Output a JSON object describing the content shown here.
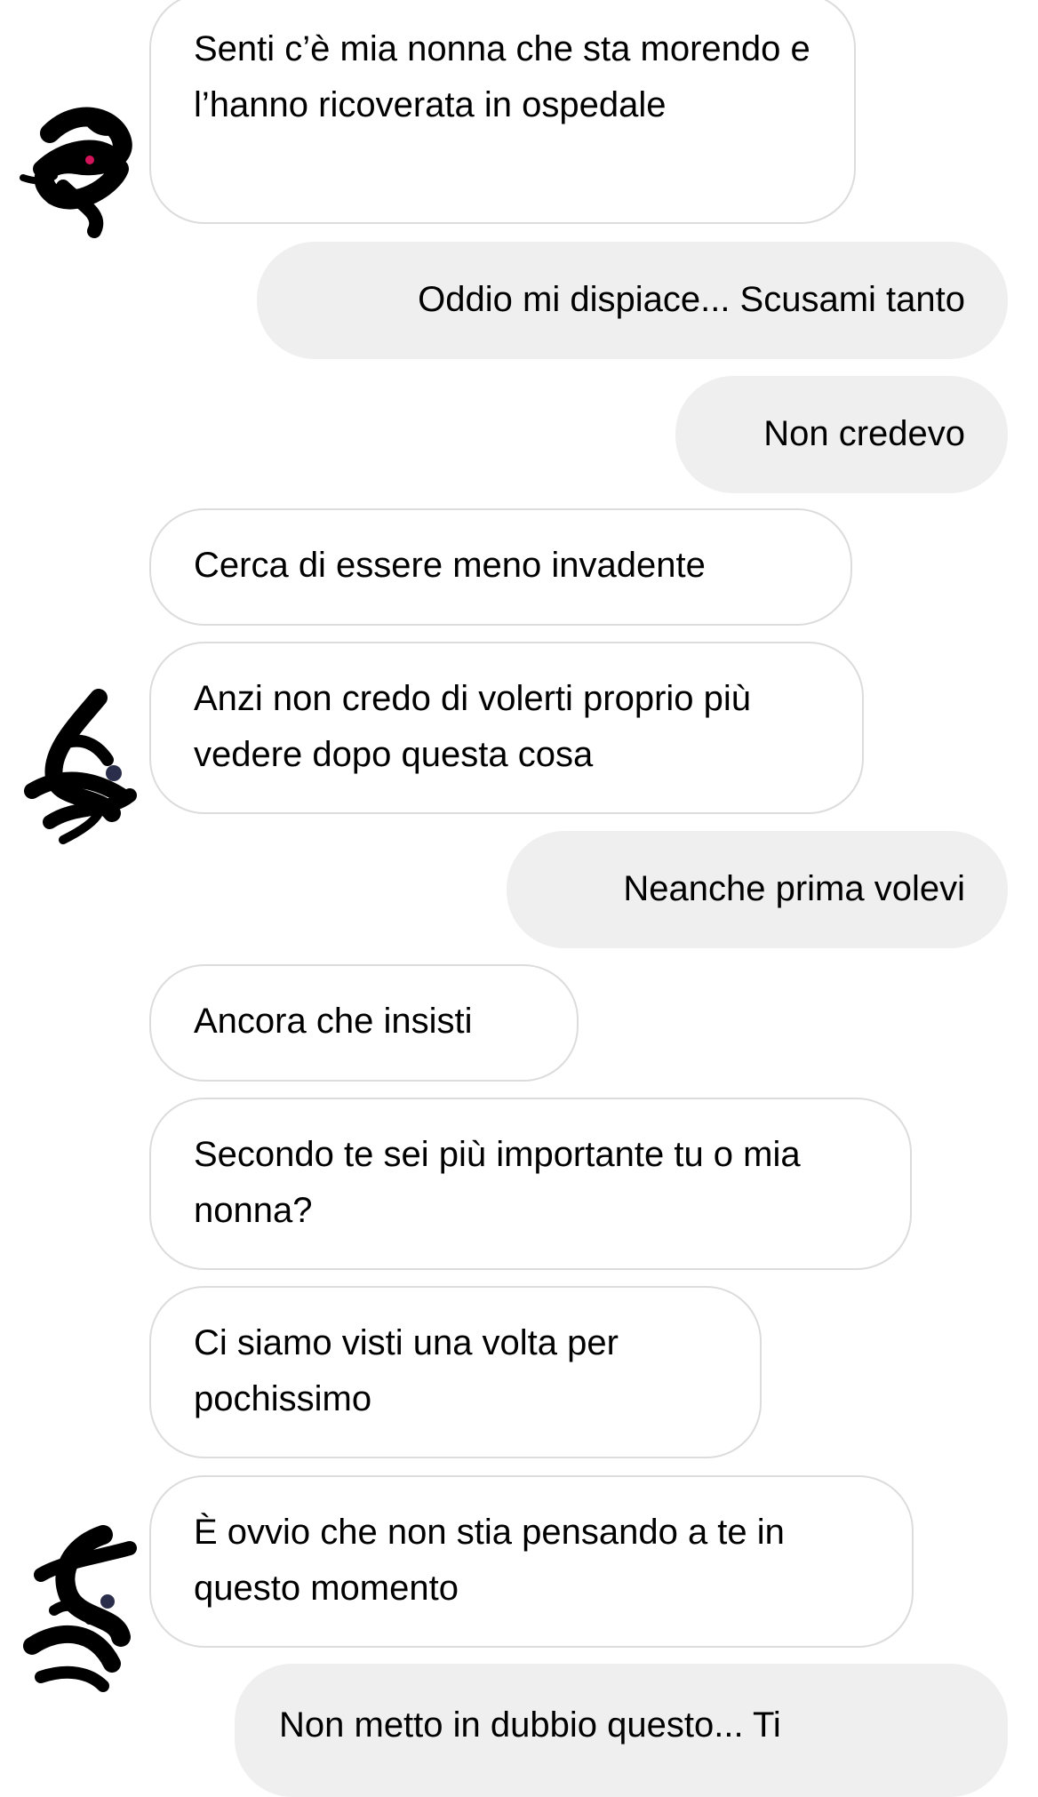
{
  "conversation": {
    "messages": [
      {
        "id": "m1",
        "direction": "received",
        "text": "Senti c’è mia nonna che sta morendo e l’hanno ricoverata in ospedale"
      },
      {
        "id": "m2",
        "direction": "sent",
        "text": "Oddio mi dispiace... Scusami tanto"
      },
      {
        "id": "m3",
        "direction": "sent",
        "text": "Non credevo"
      },
      {
        "id": "m4",
        "direction": "received",
        "text": "Cerca di essere meno invadente"
      },
      {
        "id": "m5",
        "direction": "received",
        "text": "Anzi non credo di volerti proprio più vedere dopo questa cosa"
      },
      {
        "id": "m6",
        "direction": "sent",
        "text": "Neanche prima volevi"
      },
      {
        "id": "m7",
        "direction": "received",
        "text": "Ancora che insisti"
      },
      {
        "id": "m8",
        "direction": "received",
        "text": "Secondo te sei più importante tu o mia nonna?"
      },
      {
        "id": "m9",
        "direction": "received",
        "text": "Ci siamo visti una volta per pochissimo"
      },
      {
        "id": "m10",
        "direction": "received",
        "text": "È ovvio che non stia pensando a te in questo momento"
      },
      {
        "id": "m11",
        "direction": "sent",
        "text": "Non metto in dubbio questo... Ti"
      }
    ],
    "avatars": [
      {
        "id": "a1",
        "icon": "scribbled-out-avatar-icon"
      },
      {
        "id": "a2",
        "icon": "scribbled-out-avatar-icon"
      },
      {
        "id": "a3",
        "icon": "scribbled-out-avatar-icon"
      }
    ],
    "colors": {
      "sent_bubble": "#efefef",
      "received_border": "#dcdcdc",
      "text": "#000000",
      "scribble": "#000000"
    }
  }
}
